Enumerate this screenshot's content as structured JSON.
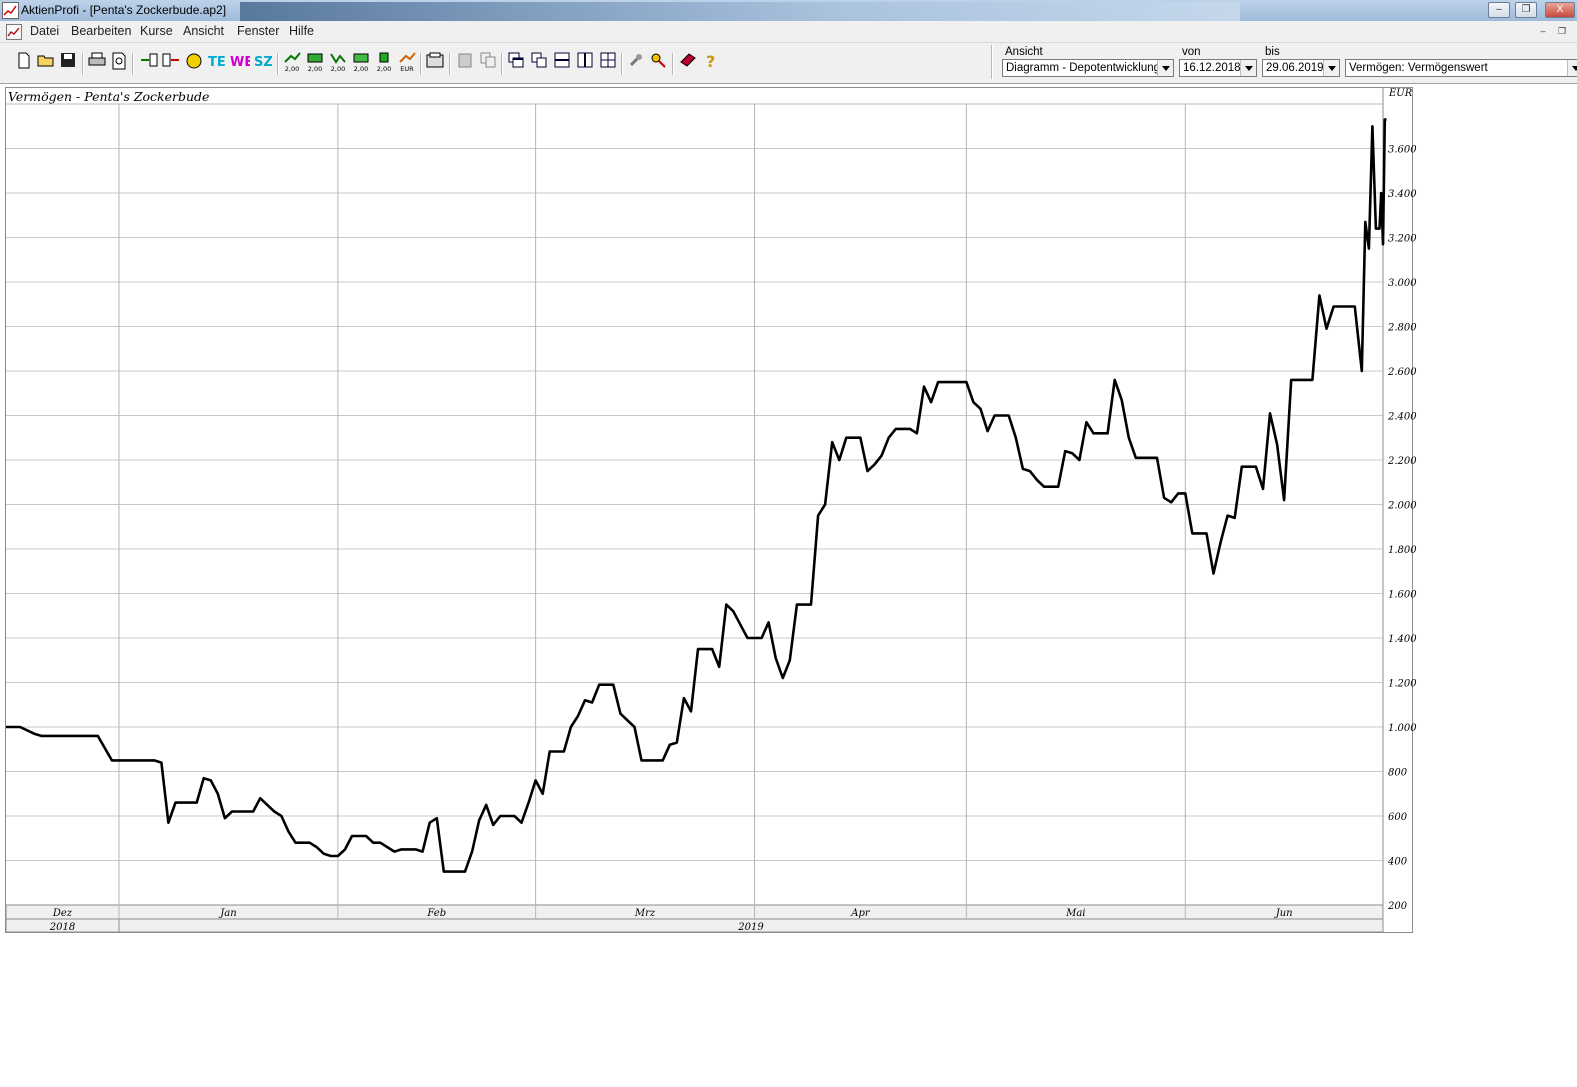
{
  "window": {
    "title": "AktienProfi - [Penta's Zockerbude.ap2]",
    "buttons": {
      "minimize": "–",
      "restore": "❐",
      "close": "X"
    }
  },
  "menu": {
    "items": [
      "Datei",
      "Bearbeiten",
      "Kurse",
      "Ansicht",
      "Fenster",
      "Hilfe"
    ]
  },
  "toolbar": {
    "icons": [
      "new-file-icon",
      "open-folder-icon",
      "save-icon",
      "print-icon",
      "print-preview-icon",
      "import-icon",
      "export-icon",
      "coins-icon",
      "te-icon",
      "we-icon",
      "sz-icon",
      "price-up-icon",
      "price-2-icon",
      "price-3-icon",
      "price-4-icon",
      "price-5-icon",
      "eur-icon",
      "calculator-icon",
      "paste-icon",
      "copy-icon",
      "cascade-icon",
      "tile-windows-icon",
      "tile-horizontal-icon",
      "tile-vertical-icon",
      "arrange-icon",
      "tools-icon",
      "key-icon",
      "book-icon",
      "help-icon"
    ],
    "icon_captions": {
      "price_up": "2,00",
      "price_2": "2,00",
      "price_3": "2,00",
      "price_4": "2,00",
      "price_5": "2,00",
      "eur": "EUR"
    },
    "ansicht": {
      "label": "Ansicht",
      "value": "Diagramm - Depotentwicklung"
    },
    "von": {
      "label": "von",
      "value": "16.12.2018"
    },
    "bis": {
      "label": "bis",
      "value": "29.06.2019"
    },
    "mode": {
      "value": "Vermögen: Vermögenswert"
    }
  },
  "chart_data": {
    "type": "line",
    "title": "Vermögen - Penta's Zockerbude",
    "ylabel": "EUR",
    "xlim": [
      "2018-12-16",
      "2019-06-29"
    ],
    "ylim": [
      200,
      3800
    ],
    "yticks": [
      200,
      400,
      600,
      800,
      1000,
      1200,
      1400,
      1600,
      1800,
      2000,
      2200,
      2400,
      2600,
      2800,
      3000,
      3200,
      3400,
      3600
    ],
    "ytick_labels": [
      "200",
      "400",
      "600",
      "800",
      "1.000",
      "1.200",
      "1.400",
      "1.600",
      "1.800",
      "2.000",
      "2.200",
      "2.400",
      "2.600",
      "2.800",
      "3.000",
      "3.200",
      "3.400",
      "3.600"
    ],
    "grid": true,
    "months": [
      {
        "label": "Dez",
        "start": "2018-12-16",
        "end": "2019-01-01"
      },
      {
        "label": "Jan",
        "start": "2019-01-01",
        "end": "2019-02-01"
      },
      {
        "label": "Feb",
        "start": "2019-02-01",
        "end": "2019-03-01"
      },
      {
        "label": "Mrz",
        "start": "2019-03-01",
        "end": "2019-04-01"
      },
      {
        "label": "Apr",
        "start": "2019-04-01",
        "end": "2019-05-01"
      },
      {
        "label": "Mai",
        "start": "2019-05-01",
        "end": "2019-06-01"
      },
      {
        "label": "Jun",
        "start": "2019-06-01",
        "end": "2019-06-29"
      }
    ],
    "years": [
      {
        "label": "2018",
        "start": "2018-12-16",
        "end": "2019-01-01"
      },
      {
        "label": "2019",
        "start": "2019-01-01",
        "end": "2019-06-29"
      }
    ],
    "series": [
      {
        "color": "#000000",
        "points": [
          [
            "2018-12-16",
            1000
          ],
          [
            "2018-12-18",
            1000
          ],
          [
            "2018-12-20",
            970
          ],
          [
            "2018-12-21",
            960
          ],
          [
            "2018-12-23",
            960
          ],
          [
            "2018-12-26",
            960
          ],
          [
            "2018-12-27",
            960
          ],
          [
            "2018-12-28",
            960
          ],
          [
            "2018-12-29",
            960
          ],
          [
            "2018-12-31",
            850
          ],
          [
            "2019-01-02",
            850
          ],
          [
            "2019-01-03",
            850
          ],
          [
            "2019-01-04",
            850
          ],
          [
            "2019-01-05",
            850
          ],
          [
            "2019-01-06",
            850
          ],
          [
            "2019-01-07",
            840
          ],
          [
            "2019-01-08",
            570
          ],
          [
            "2019-01-09",
            660
          ],
          [
            "2019-01-10",
            660
          ],
          [
            "2019-01-11",
            660
          ],
          [
            "2019-01-12",
            660
          ],
          [
            "2019-01-13",
            770
          ],
          [
            "2019-01-14",
            760
          ],
          [
            "2019-01-15",
            700
          ],
          [
            "2019-01-16",
            590
          ],
          [
            "2019-01-17",
            620
          ],
          [
            "2019-01-18",
            620
          ],
          [
            "2019-01-19",
            620
          ],
          [
            "2019-01-20",
            620
          ],
          [
            "2019-01-21",
            680
          ],
          [
            "2019-01-22",
            650
          ],
          [
            "2019-01-23",
            620
          ],
          [
            "2019-01-24",
            600
          ],
          [
            "2019-01-25",
            530
          ],
          [
            "2019-01-26",
            480
          ],
          [
            "2019-01-27",
            480
          ],
          [
            "2019-01-28",
            480
          ],
          [
            "2019-01-29",
            460
          ],
          [
            "2019-01-30",
            430
          ],
          [
            "2019-01-31",
            420
          ],
          [
            "2019-02-01",
            420
          ],
          [
            "2019-02-02",
            450
          ],
          [
            "2019-02-03",
            510
          ],
          [
            "2019-02-04",
            510
          ],
          [
            "2019-02-05",
            510
          ],
          [
            "2019-02-06",
            480
          ],
          [
            "2019-02-07",
            480
          ],
          [
            "2019-02-08",
            460
          ],
          [
            "2019-02-09",
            440
          ],
          [
            "2019-02-10",
            450
          ],
          [
            "2019-02-11",
            450
          ],
          [
            "2019-02-12",
            450
          ],
          [
            "2019-02-13",
            440
          ],
          [
            "2019-02-14",
            570
          ],
          [
            "2019-02-15",
            590
          ],
          [
            "2019-02-16",
            350
          ],
          [
            "2019-02-17",
            350
          ],
          [
            "2019-02-18",
            350
          ],
          [
            "2019-02-19",
            350
          ],
          [
            "2019-02-20",
            440
          ],
          [
            "2019-02-21",
            580
          ],
          [
            "2019-02-22",
            650
          ],
          [
            "2019-02-23",
            560
          ],
          [
            "2019-02-24",
            600
          ],
          [
            "2019-02-25",
            600
          ],
          [
            "2019-02-26",
            600
          ],
          [
            "2019-02-27",
            570
          ],
          [
            "2019-02-28",
            660
          ],
          [
            "2019-03-01",
            760
          ],
          [
            "2019-03-02",
            700
          ],
          [
            "2019-03-03",
            890
          ],
          [
            "2019-03-04",
            890
          ],
          [
            "2019-03-05",
            890
          ],
          [
            "2019-03-06",
            1000
          ],
          [
            "2019-03-07",
            1050
          ],
          [
            "2019-03-08",
            1120
          ],
          [
            "2019-03-09",
            1110
          ],
          [
            "2019-03-10",
            1190
          ],
          [
            "2019-03-11",
            1190
          ],
          [
            "2019-03-12",
            1190
          ],
          [
            "2019-03-13",
            1060
          ],
          [
            "2019-03-14",
            1030
          ],
          [
            "2019-03-15",
            1000
          ],
          [
            "2019-03-16",
            850
          ],
          [
            "2019-03-17",
            850
          ],
          [
            "2019-03-18",
            850
          ],
          [
            "2019-03-19",
            850
          ],
          [
            "2019-03-20",
            920
          ],
          [
            "2019-03-21",
            930
          ],
          [
            "2019-03-22",
            1130
          ],
          [
            "2019-03-23",
            1070
          ],
          [
            "2019-03-24",
            1350
          ],
          [
            "2019-03-25",
            1350
          ],
          [
            "2019-03-26",
            1350
          ],
          [
            "2019-03-27",
            1270
          ],
          [
            "2019-03-28",
            1550
          ],
          [
            "2019-03-29",
            1520
          ],
          [
            "2019-03-30",
            1460
          ],
          [
            "2019-03-31",
            1400
          ],
          [
            "2019-04-01",
            1400
          ],
          [
            "2019-04-02",
            1400
          ],
          [
            "2019-04-03",
            1470
          ],
          [
            "2019-04-04",
            1310
          ],
          [
            "2019-04-05",
            1220
          ],
          [
            "2019-04-06",
            1300
          ],
          [
            "2019-04-07",
            1550
          ],
          [
            "2019-04-08",
            1550
          ],
          [
            "2019-04-09",
            1550
          ],
          [
            "2019-04-10",
            1950
          ],
          [
            "2019-04-11",
            2000
          ],
          [
            "2019-04-12",
            2280
          ],
          [
            "2019-04-13",
            2200
          ],
          [
            "2019-04-14",
            2300
          ],
          [
            "2019-04-15",
            2300
          ],
          [
            "2019-04-16",
            2300
          ],
          [
            "2019-04-17",
            2150
          ],
          [
            "2019-04-18",
            2180
          ],
          [
            "2019-04-19",
            2220
          ],
          [
            "2019-04-20",
            2300
          ],
          [
            "2019-04-21",
            2340
          ],
          [
            "2019-04-22",
            2340
          ],
          [
            "2019-04-23",
            2340
          ],
          [
            "2019-04-24",
            2320
          ],
          [
            "2019-04-25",
            2530
          ],
          [
            "2019-04-26",
            2460
          ],
          [
            "2019-04-27",
            2550
          ],
          [
            "2019-04-28",
            2550
          ],
          [
            "2019-04-29",
            2550
          ],
          [
            "2019-04-30",
            2550
          ],
          [
            "2019-05-01",
            2550
          ],
          [
            "2019-05-02",
            2460
          ],
          [
            "2019-05-03",
            2430
          ],
          [
            "2019-05-04",
            2330
          ],
          [
            "2019-05-05",
            2400
          ],
          [
            "2019-05-06",
            2400
          ],
          [
            "2019-05-07",
            2400
          ],
          [
            "2019-05-08",
            2300
          ],
          [
            "2019-05-09",
            2160
          ],
          [
            "2019-05-10",
            2150
          ],
          [
            "2019-05-11",
            2110
          ],
          [
            "2019-05-12",
            2080
          ],
          [
            "2019-05-13",
            2080
          ],
          [
            "2019-05-14",
            2080
          ],
          [
            "2019-05-15",
            2240
          ],
          [
            "2019-05-16",
            2230
          ],
          [
            "2019-05-17",
            2200
          ],
          [
            "2019-05-18",
            2370
          ],
          [
            "2019-05-19",
            2320
          ],
          [
            "2019-05-20",
            2320
          ],
          [
            "2019-05-21",
            2320
          ],
          [
            "2019-05-22",
            2560
          ],
          [
            "2019-05-23",
            2470
          ],
          [
            "2019-05-24",
            2300
          ],
          [
            "2019-05-25",
            2210
          ],
          [
            "2019-05-26",
            2210
          ],
          [
            "2019-05-27",
            2210
          ],
          [
            "2019-05-28",
            2210
          ],
          [
            "2019-05-29",
            2030
          ],
          [
            "2019-05-30",
            2010
          ],
          [
            "2019-05-31",
            2050
          ],
          [
            "2019-06-01",
            2050
          ],
          [
            "2019-06-02",
            1870
          ],
          [
            "2019-06-03",
            1870
          ],
          [
            "2019-06-04",
            1870
          ],
          [
            "2019-06-05",
            1690
          ],
          [
            "2019-06-06",
            1830
          ],
          [
            "2019-06-07",
            1950
          ],
          [
            "2019-06-08",
            1940
          ],
          [
            "2019-06-09",
            2170
          ],
          [
            "2019-06-10",
            2170
          ],
          [
            "2019-06-11",
            2170
          ],
          [
            "2019-06-12",
            2070
          ],
          [
            "2019-06-13",
            2410
          ],
          [
            "2019-06-14",
            2270
          ],
          [
            "2019-06-15",
            2020
          ],
          [
            "2019-06-16",
            2560
          ],
          [
            "2019-06-17",
            2560
          ],
          [
            "2019-06-18",
            2560
          ],
          [
            "2019-06-19",
            2560
          ],
          [
            "2019-06-20",
            2940
          ],
          [
            "2019-06-21",
            2790
          ],
          [
            "2019-06-22",
            2890
          ],
          [
            "2019-06-23",
            2890
          ],
          [
            "2019-06-24",
            2890
          ],
          [
            "2019-06-25",
            2890
          ],
          [
            "2019-06-26",
            2600
          ],
          [
            "2019-06-26T12",
            3270
          ],
          [
            "2019-06-27",
            3150
          ],
          [
            "2019-06-27T12",
            3700
          ],
          [
            "2019-06-28",
            3240
          ],
          [
            "2019-06-28T06",
            3240
          ],
          [
            "2019-06-28T12",
            3240
          ],
          [
            "2019-06-28T18",
            3400
          ],
          [
            "2019-06-29",
            3170
          ],
          [
            "2019-06-29T06",
            3730
          ],
          [
            "2019-06-29T12",
            3730
          ]
        ]
      }
    ]
  }
}
